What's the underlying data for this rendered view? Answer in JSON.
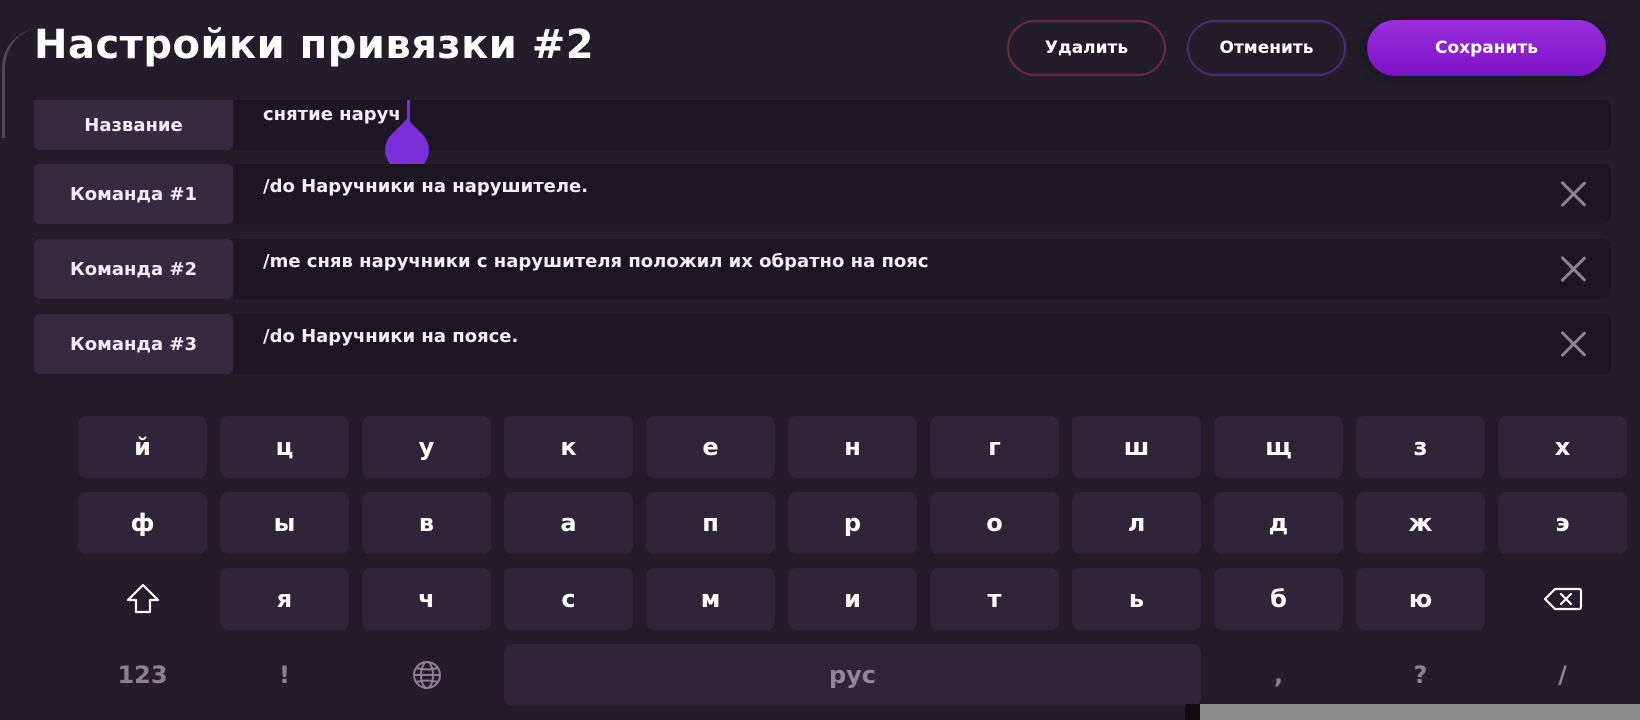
{
  "header": {
    "title": "Настройки привязки #2",
    "buttons": {
      "delete": "Удалить",
      "cancel": "Отменить",
      "save": "Сохранить"
    }
  },
  "form": {
    "name": {
      "label": "Название",
      "value": "снятие наруч"
    },
    "commands": [
      {
        "label": "Команда #1",
        "value": "/do Наручники на нарушителе."
      },
      {
        "label": "Команда #2",
        "value": "/me сняв наручники с нарушителя положил их обратно на пояс"
      },
      {
        "label": "Команда #3",
        "value": "/do Наручники на поясе."
      }
    ]
  },
  "keyboard": {
    "row1": [
      "й",
      "ц",
      "у",
      "к",
      "е",
      "н",
      "г",
      "ш",
      "щ",
      "з",
      "х"
    ],
    "row2": [
      "ф",
      "ы",
      "в",
      "а",
      "п",
      "р",
      "о",
      "л",
      "д",
      "ж",
      "э"
    ],
    "row3": [
      "я",
      "ч",
      "с",
      "м",
      "и",
      "т",
      "ь",
      "б",
      "ю"
    ],
    "row4": {
      "numbers": "123",
      "exclaim": "!",
      "space": "рус",
      "comma": ",",
      "question": "?",
      "slash": "/"
    },
    "icons": {
      "shift": "shift-icon",
      "backspace": "backspace-icon",
      "language": "globe-icon"
    }
  },
  "colors": {
    "background": "#221c2b",
    "accent": "#7b2fd8",
    "save_button": "#8a1fd2",
    "delete_border": "#6e2d39",
    "cancel_border": "#4b2f7d"
  }
}
